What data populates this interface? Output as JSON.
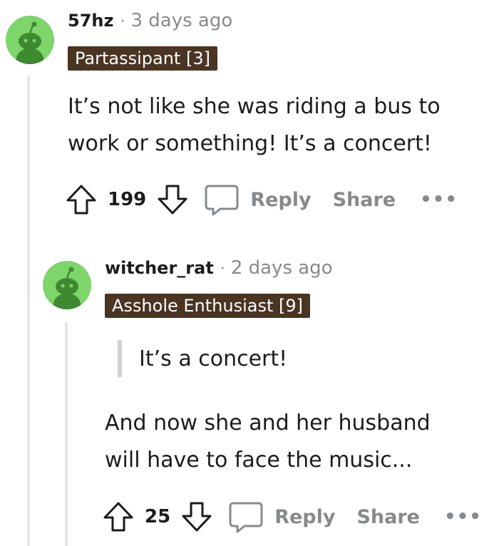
{
  "comments": [
    {
      "username": "57hz",
      "separator": "·",
      "time": "3 days ago",
      "flair": "Partassipant [3]",
      "body_line1": "It’s not like she was riding a bus to",
      "body_line2": "work or something! It’s a concert!",
      "score": "199",
      "reply_label": "Reply",
      "share_label": "Share",
      "more_label": "•••"
    },
    {
      "username": "witcher_rat",
      "separator": "·",
      "time": "2 days ago",
      "flair": "Asshole Enthusiast [9]",
      "quote": "It’s a concert!",
      "body_line1": "And now she and her husband",
      "body_line2": "will have to face the music...",
      "score": "25",
      "reply_label": "Reply",
      "share_label": "Share",
      "more_label": "•••"
    }
  ],
  "colors": {
    "avatar_bg": "#7ed66a",
    "flair_bg": "#4a3422",
    "muted_text": "#878a8c",
    "thread_line": "#e6e6e6"
  },
  "icons": [
    "snoo-avatar-icon",
    "upvote-icon",
    "downvote-icon",
    "comment-bubble-icon"
  ]
}
